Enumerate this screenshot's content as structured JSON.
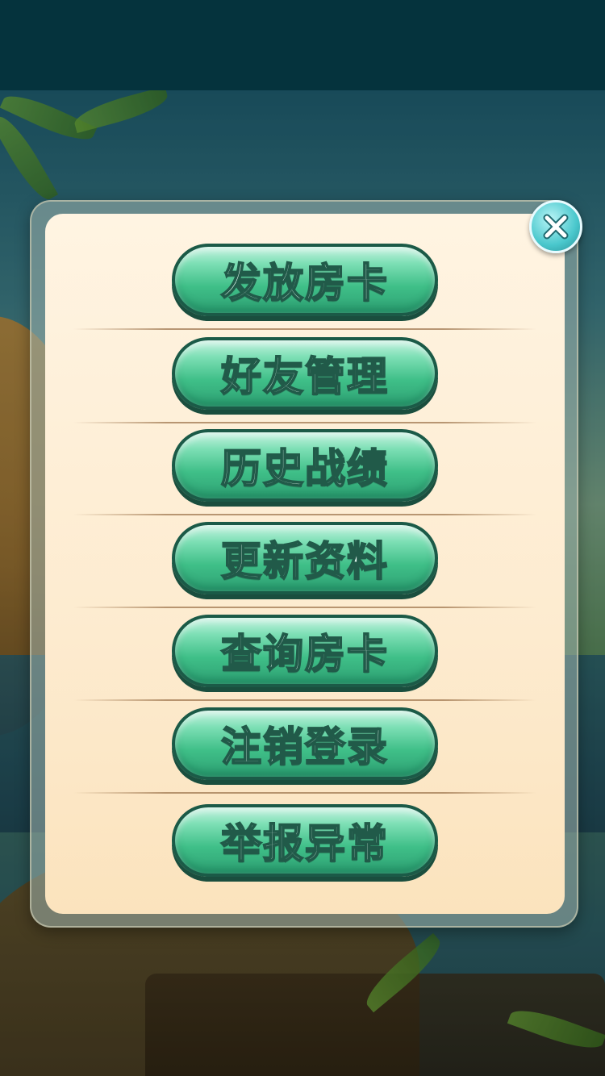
{
  "menu": {
    "items": [
      {
        "label": "发放房卡"
      },
      {
        "label": "好友管理"
      },
      {
        "label": "历史战绩"
      },
      {
        "label": "更新资料"
      },
      {
        "label": "查询房卡"
      },
      {
        "label": "注销登录"
      },
      {
        "label": "举报异常"
      }
    ]
  },
  "icons": {
    "close": "close-icon"
  },
  "colors": {
    "button_fill": "#3fbf88",
    "button_border": "#1b5a47",
    "panel_background": "#fdebcf",
    "close_button": "#49c7cc",
    "top_bar": "#05333d"
  }
}
